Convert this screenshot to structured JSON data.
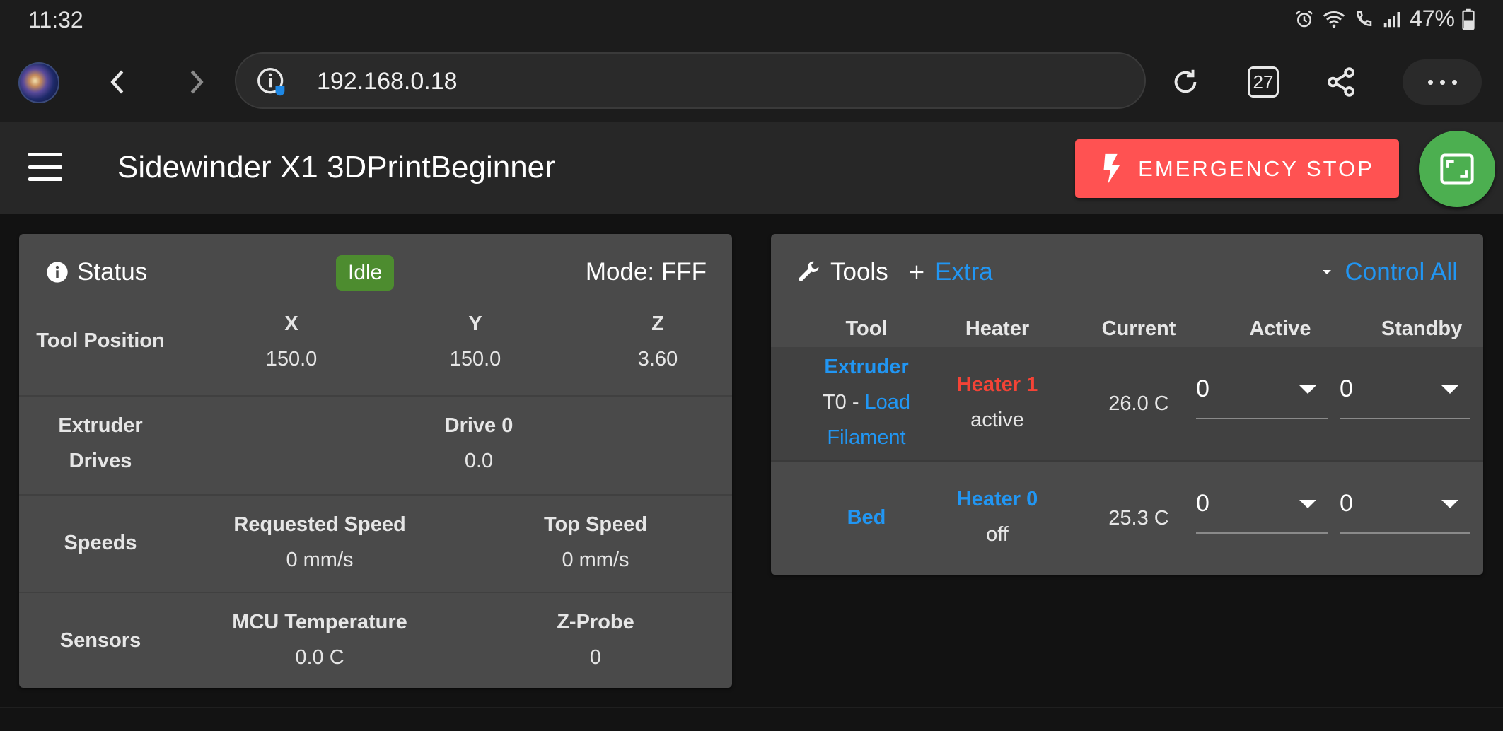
{
  "statusbar": {
    "time": "11:32",
    "battery": "47%"
  },
  "browser": {
    "url": "192.168.0.18",
    "tab_count": "27"
  },
  "appbar": {
    "title": "Sidewinder X1 3DPrintBeginner",
    "emergency_stop": "EMERGENCY STOP"
  },
  "status_card": {
    "title": "Status",
    "state_badge": "Idle",
    "mode": "Mode: FFF",
    "tool_position": {
      "label": "Tool Position",
      "axes": [
        {
          "name": "X",
          "value": "150.0"
        },
        {
          "name": "Y",
          "value": "150.0"
        },
        {
          "name": "Z",
          "value": "3.60"
        }
      ]
    },
    "extruder": {
      "label_line1": "Extruder",
      "label_line2": "Drives",
      "drive_name": "Drive 0",
      "drive_value": "0.0"
    },
    "speeds": {
      "label": "Speeds",
      "requested_label": "Requested Speed",
      "requested_value": "0 mm/s",
      "top_label": "Top Speed",
      "top_value": "0 mm/s"
    },
    "sensors": {
      "label": "Sensors",
      "mcu_label": "MCU Temperature",
      "mcu_value": "0.0 C",
      "zprobe_label": "Z-Probe",
      "zprobe_value": "0"
    }
  },
  "tools_card": {
    "title": "Tools",
    "extra_label": "Extra",
    "control_all": "Control All",
    "columns": [
      "Tool",
      "Heater",
      "Current",
      "Active",
      "Standby"
    ],
    "rows": [
      {
        "tool": "Extruder",
        "tool_sub_prefix": "T0 - ",
        "tool_sub_link1": "Load",
        "tool_sub_link2": "Filament",
        "heater": "Heater 1",
        "heater_state": "active",
        "current": "26.0 C",
        "active": "0",
        "standby": "0"
      },
      {
        "tool": "Bed",
        "heater": "Heater 0",
        "heater_state": "off",
        "current": "25.3 C",
        "active": "0",
        "standby": "0"
      }
    ]
  },
  "colors": {
    "accent_blue": "#2196f3",
    "estop_red": "#ff5252",
    "idle_green": "#4d8c2f",
    "fab_green": "#4caf50",
    "heater_active_red": "#f44336"
  }
}
